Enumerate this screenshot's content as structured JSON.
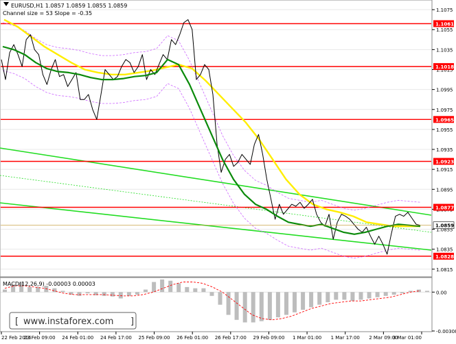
{
  "chart_data": [
    {
      "type": "line",
      "panel": "price",
      "header": "EURUSD,H1  1.0857 1.0859 1.0855 1.0859",
      "subheader": "Channel size = 53 Slope = -0.35",
      "ylim": [
        1.0808,
        1.1084
      ],
      "y_ticks": [
        "1.1075",
        "1.1055",
        "1.1035",
        "1.1015",
        "1.0995",
        "1.0975",
        "1.0955",
        "1.0935",
        "1.0915",
        "1.0895",
        "1.0875",
        "1.0855",
        "1.0835",
        "1.0815"
      ],
      "x_ticks": [
        "22 Feb 2016",
        "23 Feb 09:00",
        "24 Feb 01:00",
        "24 Feb 17:00",
        "25 Feb 09:00",
        "26 Feb 01:00",
        "26 Feb 17:00",
        "29 Feb 09:00",
        "1 Mar 01:00",
        "1 Mar 17:00",
        "2 Mar 09:00",
        "3 Mar 01:00"
      ],
      "levels": [
        {
          "label": "1.1061",
          "value": 1.1061
        },
        {
          "label": "1.1018",
          "value": 1.1018
        },
        {
          "label": "1.0965",
          "value": 1.0965
        },
        {
          "label": "1.0923",
          "value": 1.0923
        },
        {
          "label": "1.0877",
          "value": 1.0877
        },
        {
          "label": "1.0828",
          "value": 1.0828
        }
      ],
      "current_price": {
        "label": "1.0859",
        "value": 1.0859
      },
      "series": [
        {
          "key": "price",
          "color": "#000000",
          "values": [
            1.1025,
            1.1005,
            1.1032,
            1.104,
            1.103,
            1.1018,
            1.1045,
            1.105,
            1.1035,
            1.103,
            1.101,
            1.1,
            1.1015,
            1.1025,
            1.1008,
            1.101,
            1.0998,
            1.1005,
            1.1012,
            1.0985,
            1.0985,
            1.099,
            1.0975,
            1.0965,
            1.099,
            1.1015,
            1.101,
            1.1005,
            1.1008,
            1.1018,
            1.1025,
            1.1022,
            1.1012,
            1.1018,
            1.103,
            1.1005,
            1.1015,
            1.101,
            1.102,
            1.103,
            1.1025,
            1.1045,
            1.104,
            1.105,
            1.1062,
            1.1065,
            1.1055,
            1.1005,
            1.101,
            1.102,
            1.1015,
            1.099,
            1.094,
            1.0912,
            1.0925,
            1.093,
            1.0918,
            1.0922,
            1.093,
            1.0925,
            1.092,
            1.094,
            1.095,
            1.093,
            1.0905,
            1.0885,
            1.0865,
            1.088,
            1.087,
            1.0875,
            1.088,
            1.0878,
            1.0882,
            1.0876,
            1.088,
            1.0885,
            1.087,
            1.0862,
            1.0858,
            1.087,
            1.0845,
            1.0862,
            1.087,
            1.0868,
            1.0865,
            1.086,
            1.0855,
            1.0852,
            1.0857,
            1.0848,
            1.084,
            1.0848,
            1.084,
            1.083,
            1.085,
            1.0868,
            1.087,
            1.0868,
            1.0872,
            1.0866,
            1.086,
            1.0859
          ]
        },
        {
          "key": "ma_green",
          "color": "#0a8a0a",
          "values": [
            1.1038,
            1.1035,
            1.103,
            1.1022,
            1.1016,
            1.1013,
            1.1012,
            1.101,
            1.1007,
            1.1005,
            1.1005,
            1.1006,
            1.1008,
            1.1009,
            1.1012,
            1.1025,
            1.102,
            1.1,
            1.0975,
            1.095,
            1.0925,
            1.0905,
            1.089,
            1.088,
            1.0875,
            1.0868,
            1.0862,
            1.086,
            1.0858,
            1.086,
            1.0856,
            1.0852,
            1.085,
            1.0852,
            1.0855,
            1.0858,
            1.086,
            1.0859,
            1.0858
          ]
        },
        {
          "key": "ma_yellow",
          "color": "#ffee00",
          "values": [
            1.1065,
            1.1058,
            1.1048,
            1.1038,
            1.103,
            1.1022,
            1.1015,
            1.1012,
            1.101,
            1.101,
            1.1012,
            1.1014,
            1.1017,
            1.102,
            1.1016,
            1.1004,
            1.099,
            1.0976,
            1.0962,
            1.0945,
            1.0925,
            1.0905,
            1.089,
            1.088,
            1.0875,
            1.0872,
            1.0868,
            1.0862,
            1.086,
            1.0858,
            1.0858,
            1.0858
          ]
        }
      ]
    },
    {
      "type": "bar",
      "panel": "macd",
      "title": "MACD(12,26,9) -0.00003 0.00003",
      "ylim": [
        -0.00308,
        0.0011
      ],
      "y_ticks": [
        "0.00",
        "-0.00308"
      ],
      "histogram": [
        0.0002,
        0.0006,
        0.0008,
        0.0004,
        0.0004,
        0.0005,
        0.0003,
        0.0001,
        -0.0002,
        -0.0003,
        -0.0001,
        -0.00025,
        -0.0003,
        -0.00035,
        -0.0005,
        -0.0003,
        -0.0002,
        0.0002,
        0.0008,
        0.001,
        0.0009,
        0.0007,
        0.0004,
        0.0003,
        0.0003,
        -0.0003,
        -0.001,
        -0.0018,
        -0.0022,
        -0.0024,
        -0.0024,
        -0.0023,
        -0.0022,
        -0.002,
        -0.0018,
        -0.0016,
        -0.0014,
        -0.0012,
        -0.001,
        -0.0008,
        -0.0006,
        -0.0006,
        -0.0007,
        -0.0006,
        -0.0005,
        -0.0004,
        -0.0003,
        -0.0002,
        -0.0001,
        0.0001,
        0.0002,
        0.0001
      ],
      "signal": [
        0.0003,
        0.0005,
        0.0005,
        0.0004,
        0.0003,
        0.0001,
        -0.0001,
        -0.0002,
        -0.0002,
        -0.0002,
        -0.0002,
        -0.00025,
        -0.0003,
        -0.0003,
        -0.0002,
        0.0,
        0.0003,
        0.0006,
        0.0008,
        0.0008,
        0.0007,
        0.0004,
        0.0,
        -0.0006,
        -0.0012,
        -0.0018,
        -0.0021,
        -0.0022,
        -0.0021,
        -0.0019,
        -0.0016,
        -0.0013,
        -0.0011,
        -0.0009,
        -0.0008,
        -0.0007,
        -0.0007,
        -0.0006,
        -0.0005,
        -0.0004,
        -0.0002,
        0.0,
        0.0001
      ]
    }
  ],
  "watermark": "www.instaforex.com",
  "colors": {
    "background": "#ffffff",
    "level": "#ff0000",
    "channel": "#22dd22",
    "ma_green": "#0a8a0a",
    "ma_yellow": "#ffee00",
    "bollinger": "#cc66ff",
    "macd_hist": "#bdbdbd",
    "macd_signal": "#ff0000"
  }
}
